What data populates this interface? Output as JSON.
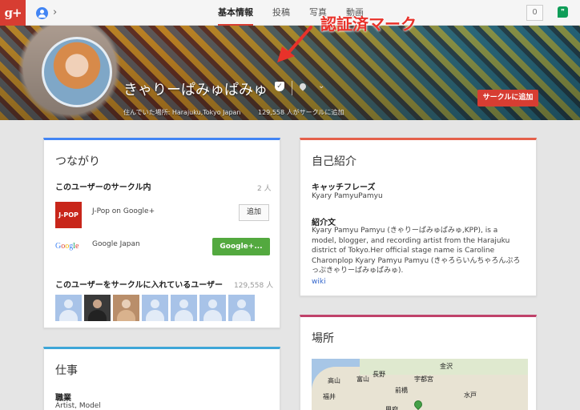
{
  "topbar": {
    "logo": "g+",
    "tabs": [
      {
        "label": "基本情報",
        "active": true
      },
      {
        "label": "投稿"
      },
      {
        "label": "写真"
      },
      {
        "label": "動画"
      }
    ],
    "notification_count": "0"
  },
  "profile": {
    "name": "きゃりーぱみゅぱみゅ",
    "lived": "住んでいた場所: Harajuku,Tokyo Japan",
    "circled_by": "129,558 人がサークルに追加",
    "add_button": "サークルに追加"
  },
  "annotation": {
    "text": "認証済マーク",
    "color": "#e8322a"
  },
  "connections": {
    "title": "つながり",
    "in_circles_label": "このユーザーのサークル内",
    "in_circles_count": "2 人",
    "items": [
      {
        "logo": "J-POP",
        "name": "J-Pop on Google+",
        "button": "追加"
      },
      {
        "logo": "Google",
        "name": "Google Japan",
        "button": "Google+..."
      }
    ],
    "have_in_circles_label": "このユーザーをサークルに入れているユーザー",
    "have_in_circles_count": "129,558 人"
  },
  "intro": {
    "title": "自己紹介",
    "tagline_label": "キャッチフレーズ",
    "tagline": "Kyary PamyuPamyu",
    "intro_label": "紹介文",
    "intro_text": "Kyary Pamyu Pamyu (きゃりーぱみゅぱみゅ,KPP), is a model, blogger, and recording artist from the Harajuku district of Tokyo.Her official stage name is Caroline Charonplop Kyary Pamyu Pamyu (きゃろらいんちゃろんぷろっぷきゃりーぱみゅぱみゅ).",
    "wiki_link": "wiki"
  },
  "work": {
    "title": "仕事",
    "occupation_label": "職業",
    "occupation": "Artist, Model"
  },
  "places": {
    "title": "場所",
    "map_labels": [
      "富山",
      "長野",
      "宇都宮",
      "水戸",
      "福井",
      "前橋",
      "甲府",
      "高山",
      "金沢"
    ]
  },
  "colors": {
    "brand_red": "#d73d32",
    "connections_bar": "#4285f4",
    "intro_bar": "#e5604a",
    "work_bar": "#3ea6d8",
    "places_bar": "#c0426a",
    "green_button": "#53a93f"
  }
}
